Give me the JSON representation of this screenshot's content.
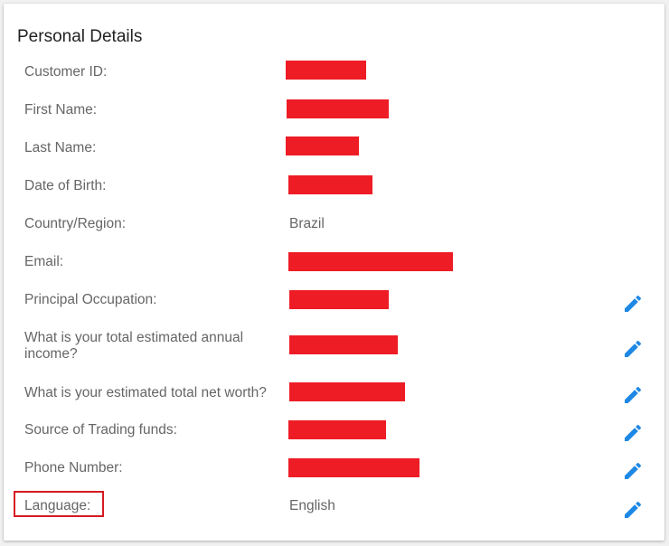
{
  "card": {
    "title": "Personal Details"
  },
  "fields": {
    "customer_id": {
      "label": "Customer ID:"
    },
    "first_name": {
      "label": "First Name:"
    },
    "last_name": {
      "label": "Last Name:"
    },
    "date_of_birth": {
      "label": "Date of Birth:"
    },
    "country": {
      "label": "Country/Region:",
      "value": "Brazil"
    },
    "email": {
      "label": "Email:"
    },
    "occupation": {
      "label": "Principal Occupation:"
    },
    "annual_income": {
      "label": "What is your total estimated annual income?"
    },
    "net_worth": {
      "label": "What is your estimated total net worth?"
    },
    "trading_funds": {
      "label": "Source of Trading funds:"
    },
    "phone": {
      "label": "Phone Number:"
    },
    "language": {
      "label": "Language:",
      "value": "English"
    }
  },
  "colors": {
    "redaction": "#ee1c25",
    "edit_icon": "#1e88e5",
    "highlight_border": "#d61a22"
  },
  "icons": {
    "edit": "pencil-icon"
  }
}
